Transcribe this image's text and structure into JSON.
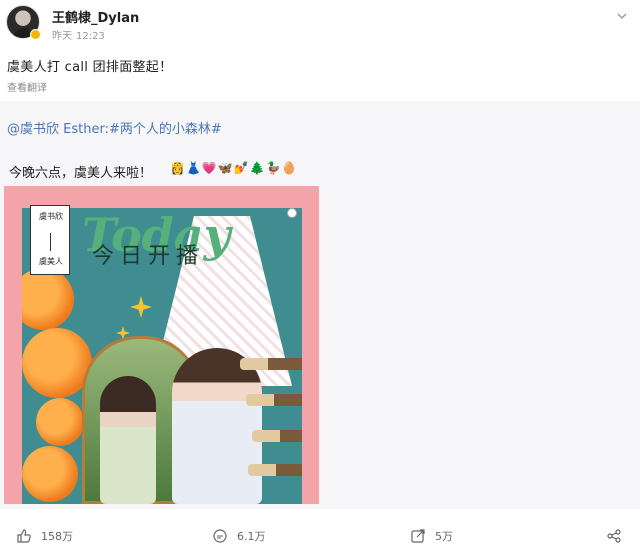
{
  "post": {
    "username": "王鹤棣_Dylan",
    "time_day": "昨天",
    "time_clock": "12:23",
    "text": "虞美人打 call 团排面整起！",
    "translate_label": "查看翻译"
  },
  "repost": {
    "author_line": "@虞书欣 Esther:#两个人的小森林#",
    "text": "今晚六点，虞美人来啦！",
    "emojis": "👸👗💗🦋💅🌲🦆🥚",
    "image": {
      "overlay_word": "Today",
      "overlay_cn": "今日开播",
      "tag_top": "虞书欣",
      "tag_bottom": "虞美人"
    }
  },
  "actions": {
    "likes": "158万",
    "comments": "6.1万",
    "reposts": "5万"
  },
  "icons": [
    "chevron-down-icon",
    "like-icon",
    "comment-icon",
    "repost-icon",
    "share-icon"
  ]
}
